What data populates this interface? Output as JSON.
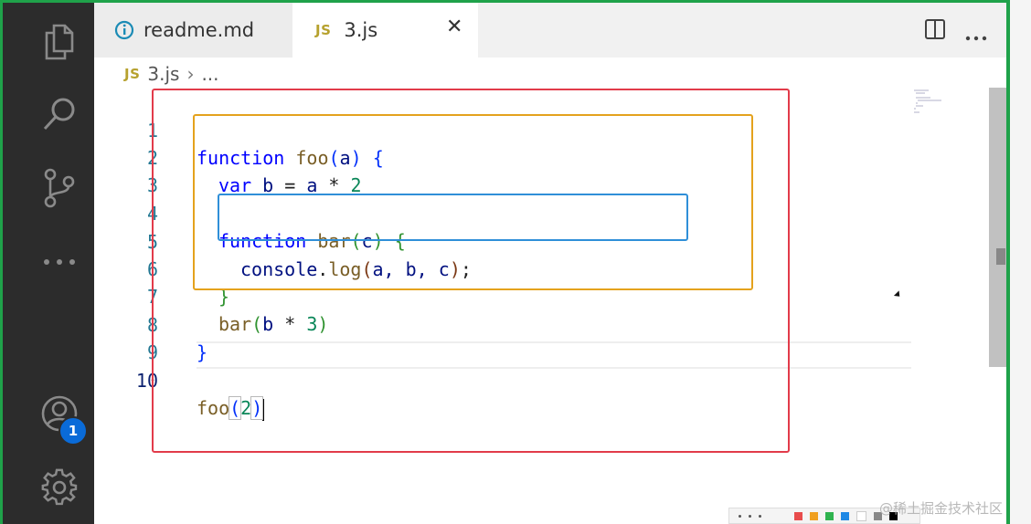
{
  "tabs": [
    {
      "label": "readme.md",
      "icon": "info-icon",
      "active": false
    },
    {
      "label": "3.js",
      "icon": "js-file-icon",
      "active": true,
      "close": "✕"
    }
  ],
  "breadcrumb": {
    "icon_text": "JS",
    "file": "3.js",
    "sep": "›",
    "rest": "..."
  },
  "file_icon_text": "JS",
  "activity": {
    "badge": "1"
  },
  "editor": {
    "lines": [
      {
        "n": "1"
      },
      {
        "n": "2"
      },
      {
        "n": "3"
      },
      {
        "n": "4"
      },
      {
        "n": "5"
      },
      {
        "n": "6"
      },
      {
        "n": "7"
      },
      {
        "n": "8"
      },
      {
        "n": "9"
      },
      {
        "n": "10"
      }
    ],
    "code": {
      "l1_kw": "function",
      "l1_name": "foo",
      "l1_open": "(",
      "l1_param": "a",
      "l1_close": ")",
      "l1_brace": "{",
      "l2_kw": "var",
      "l2_rest_b": "b",
      "l2_eq": " = ",
      "l2_a": "a",
      "l2_op": " * ",
      "l2_num": "2",
      "l4_kw": "function",
      "l4_name": "bar",
      "l4_open": "(",
      "l4_param": "c",
      "l4_close": ")",
      "l4_brace": "{",
      "l5_obj": "console",
      "l5_dot": ".",
      "l5_fn": "log",
      "l5_open": "(",
      "l5_args": "a, b, c",
      "l5_close": ")",
      "l5_semi": ";",
      "l6_brace": "}",
      "l7_fn": "bar",
      "l7_open": "(",
      "l7_b": "b",
      "l7_op": " * ",
      "l7_num": "3",
      "l7_close": ")",
      "l8_brace": "}",
      "l10_fn": "foo",
      "l10_open": "(",
      "l10_num": "2",
      "l10_close": ")"
    }
  },
  "watermark": "@稀土掘金技术社区",
  "colors": {
    "red_box": "#e23b4a",
    "orange_box": "#e4a21d",
    "blue_box": "#2f8fd8",
    "frame": "#1fa24a"
  },
  "toolbar_colors": [
    "#e84c4c",
    "#f0a020",
    "#2fb34f",
    "#1e88e5",
    "#ffffff",
    "#888888",
    "#000000"
  ]
}
